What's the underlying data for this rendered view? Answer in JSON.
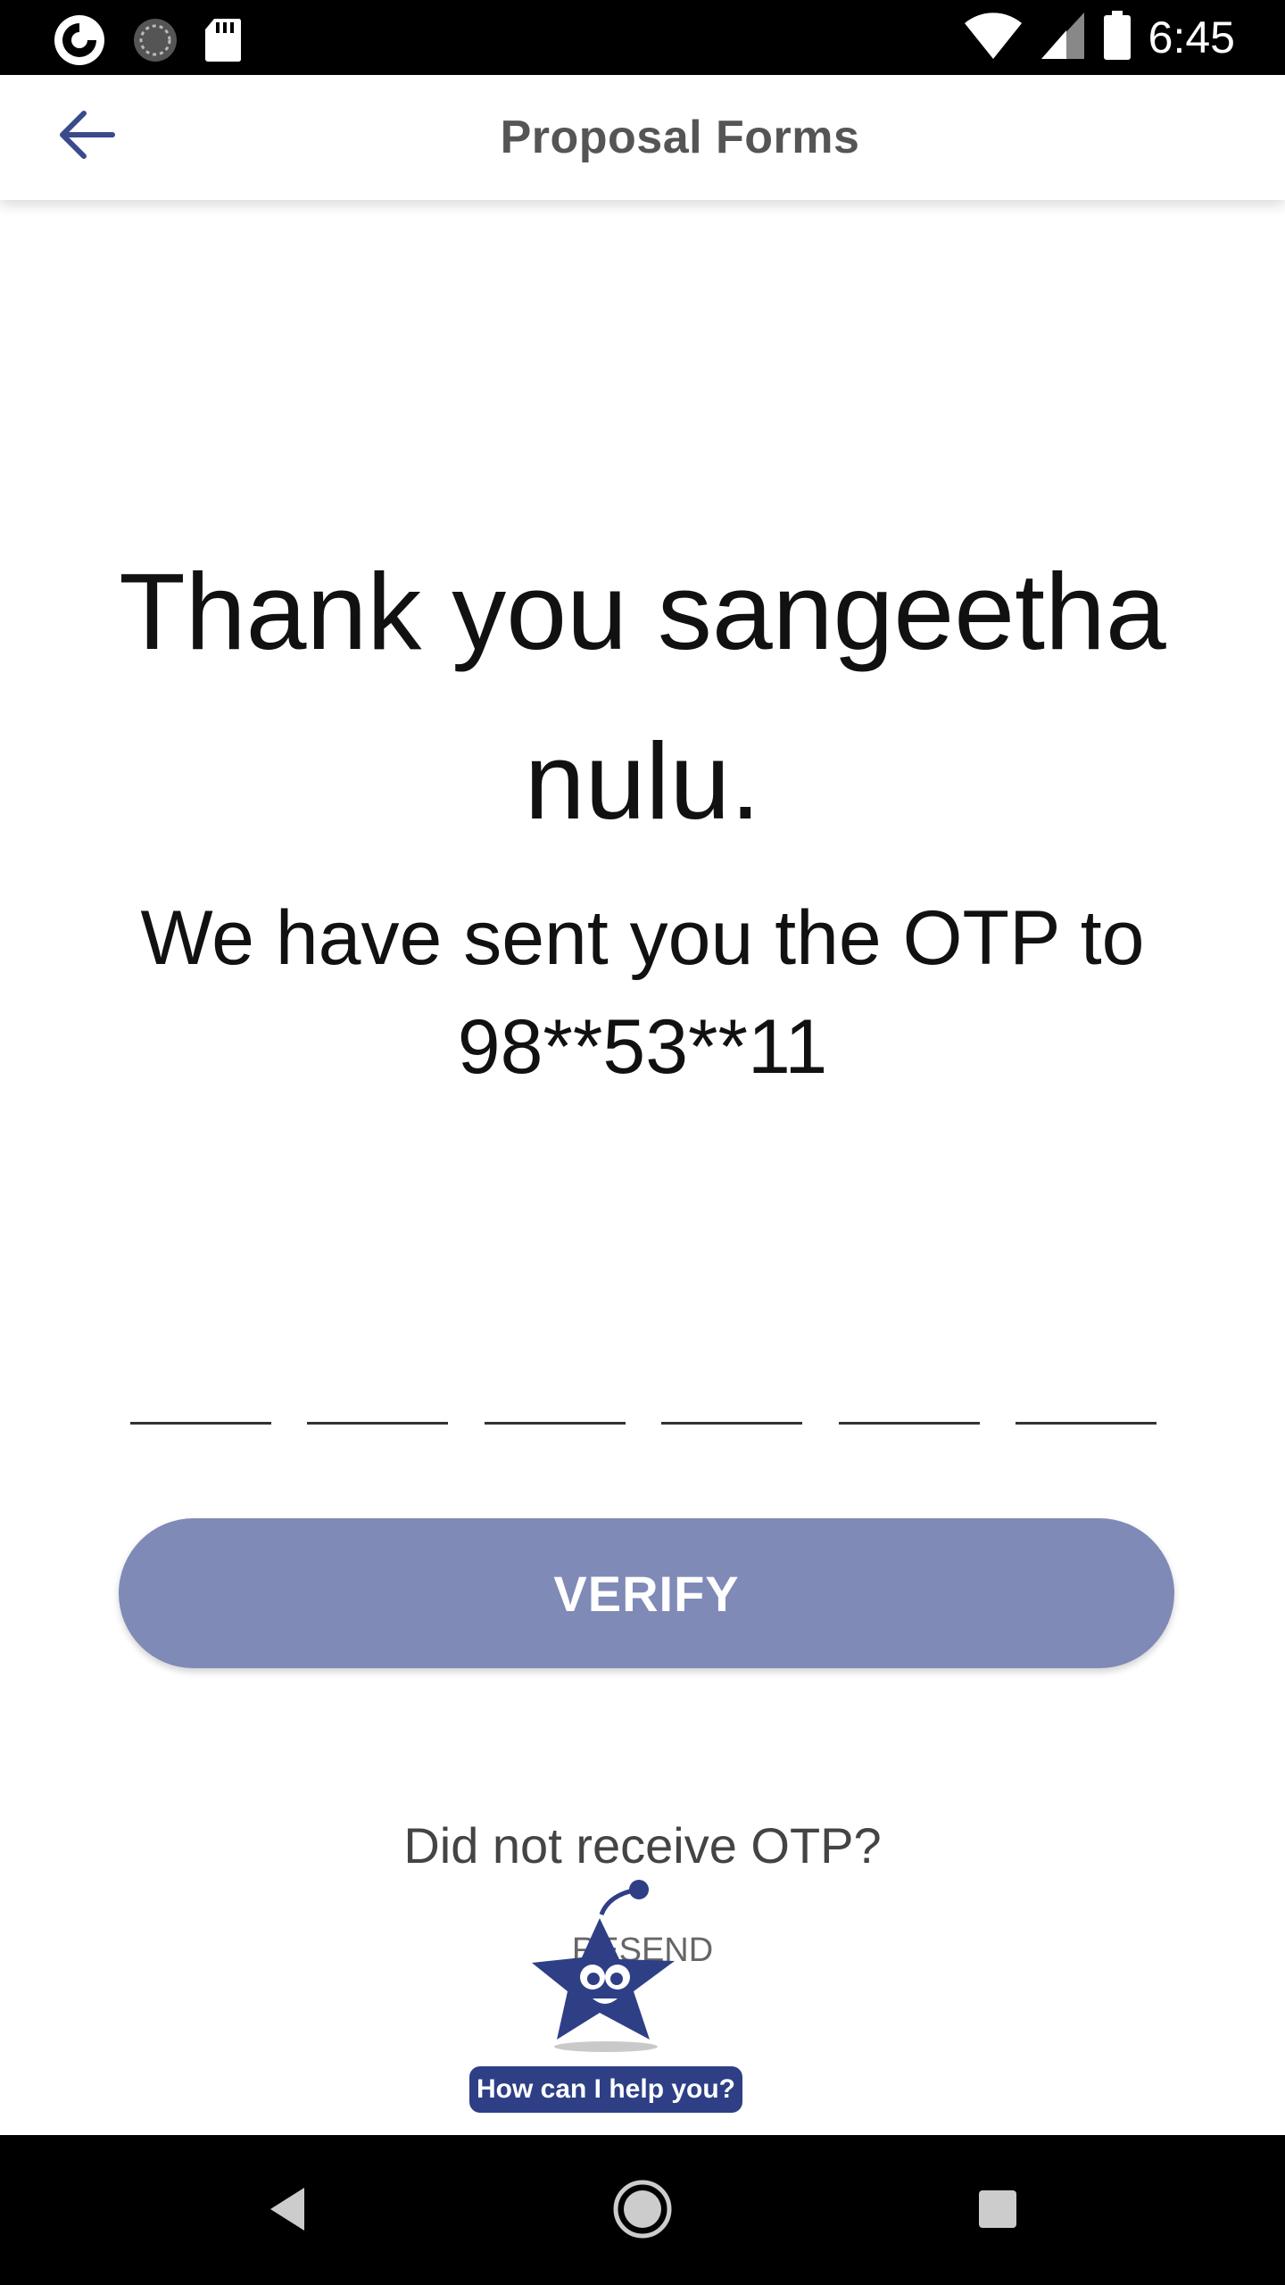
{
  "status_bar": {
    "time": "6:45",
    "left_icons": [
      "app-notification-icon",
      "sync-icon",
      "sd-card-icon"
    ],
    "right_icons": [
      "wifi-icon",
      "cell-signal-icon",
      "battery-icon"
    ]
  },
  "app_bar": {
    "back_icon": "arrow-left-icon",
    "title": "Proposal Forms"
  },
  "main": {
    "thank_you_line1": "Thank you sangeetha",
    "thank_you_line2": "nulu.",
    "otp_line1": "We have sent you the OTP to",
    "otp_line2": "98**53**11",
    "otp_digits": [
      "",
      "",
      "",
      "",
      "",
      ""
    ],
    "verify_label": "VERIFY",
    "not_received": "Did not receive OTP?",
    "resend_label": "RESEND"
  },
  "chatbot": {
    "label": "How can I help you?",
    "icon": "star-mascot-icon"
  },
  "nav_bar": {
    "icons": [
      "back-triangle-icon",
      "home-circle-icon",
      "recents-square-icon"
    ]
  },
  "colors": {
    "accent": "#2e3f86",
    "verify_button": "#7f8ab7",
    "title_text": "#555555"
  }
}
